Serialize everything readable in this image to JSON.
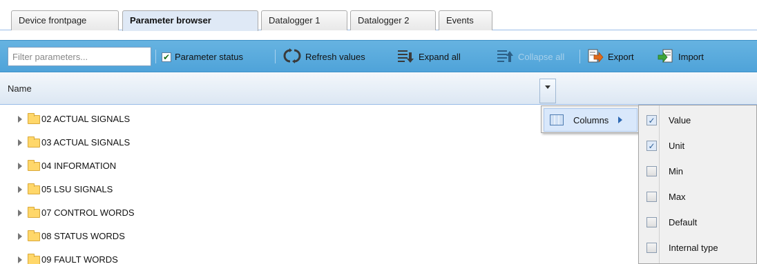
{
  "tabs": [
    {
      "label": "Device frontpage",
      "active": false
    },
    {
      "label": "Parameter browser",
      "active": true
    },
    {
      "label": "Datalogger 1",
      "active": false
    },
    {
      "label": "Datalogger 2",
      "active": false
    },
    {
      "label": "Events",
      "active": false
    }
  ],
  "toolbar": {
    "filter_placeholder": "Filter parameters...",
    "parameter_status_label": "Parameter status",
    "parameter_status_checked": true,
    "refresh_label": "Refresh values",
    "expand_label": "Expand all",
    "collapse_label": "Collapse all",
    "export_label": "Export",
    "import_label": "Import"
  },
  "grid": {
    "column_name": "Name",
    "rows": [
      "02 ACTUAL SIGNALS",
      "03 ACTUAL SIGNALS",
      "04 INFORMATION",
      "05 LSU SIGNALS",
      "07 CONTROL WORDS",
      "08 STATUS WORDS",
      "09 FAULT WORDS"
    ]
  },
  "column_menu": {
    "columns_label": "Columns",
    "items": [
      {
        "label": "Value",
        "checked": true
      },
      {
        "label": "Unit",
        "checked": true
      },
      {
        "label": "Min",
        "checked": false
      },
      {
        "label": "Max",
        "checked": false
      },
      {
        "label": "Default",
        "checked": false
      },
      {
        "label": "Internal type",
        "checked": false
      }
    ]
  },
  "icons": {
    "refresh": "refresh-icon",
    "expand": "expand-all-icon",
    "collapse": "collapse-all-icon",
    "export": "export-icon",
    "import": "import-icon",
    "folder": "folder-icon"
  }
}
